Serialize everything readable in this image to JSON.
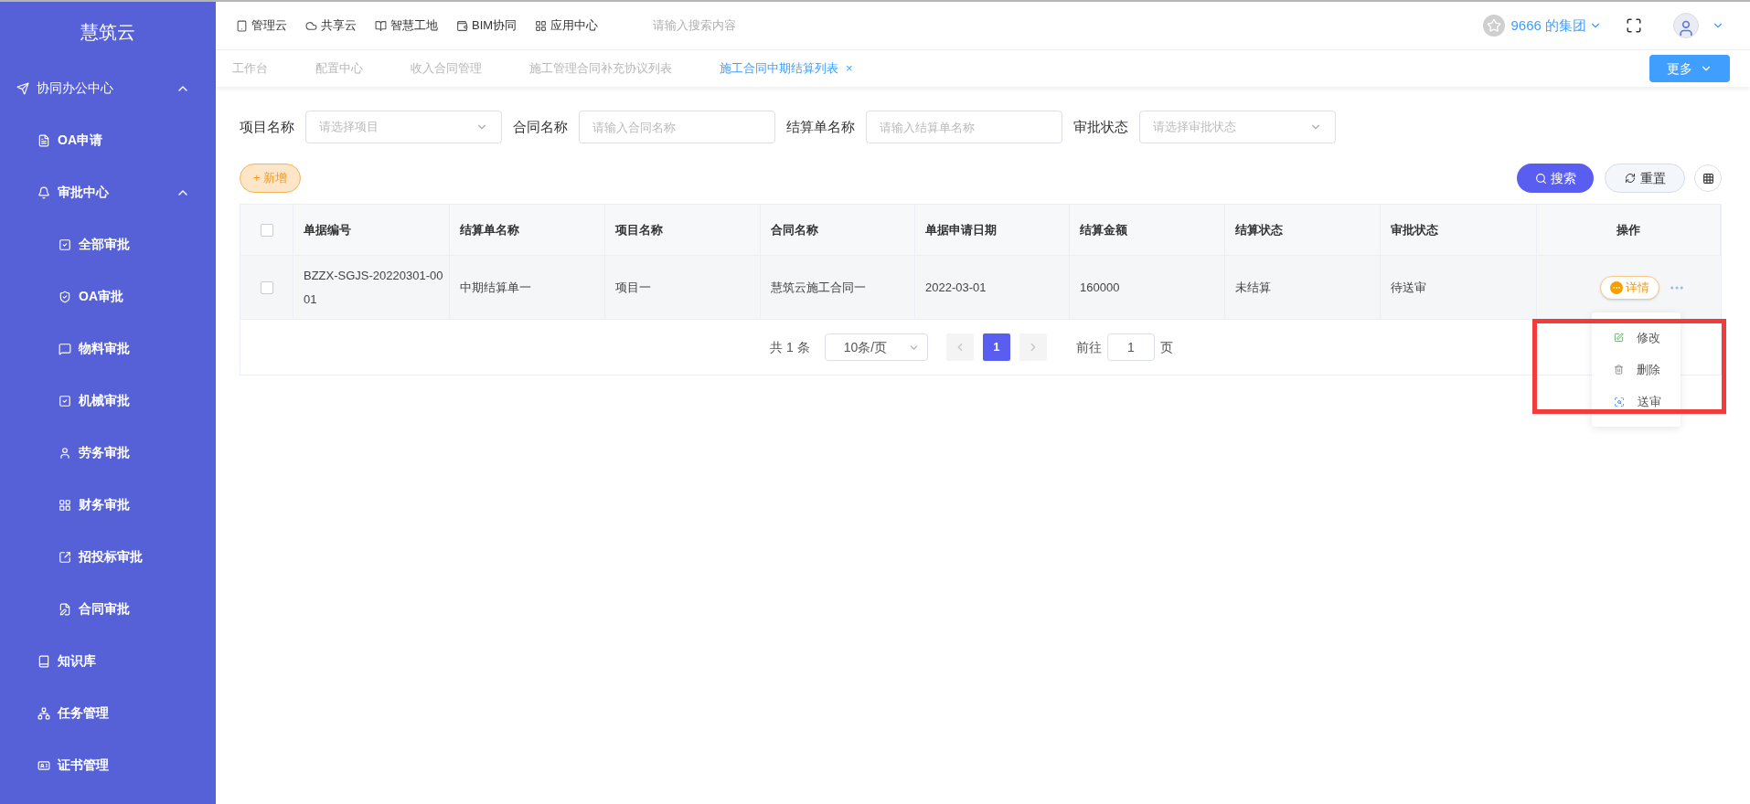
{
  "sidebar": {
    "title": "慧筑云",
    "items": [
      {
        "label": "协同办公中心",
        "expanded": true,
        "children": [
          {
            "label": "OA申请"
          },
          {
            "label": "审批中心",
            "expanded": true,
            "children": [
              {
                "label": "全部审批"
              },
              {
                "label": "OA审批"
              },
              {
                "label": "物料审批"
              },
              {
                "label": "机械审批"
              },
              {
                "label": "劳务审批"
              },
              {
                "label": "财务审批"
              },
              {
                "label": "招投标审批"
              },
              {
                "label": "合同审批"
              }
            ]
          },
          {
            "label": "知识库"
          },
          {
            "label": "任务管理"
          },
          {
            "label": "证书管理"
          }
        ]
      }
    ]
  },
  "top_nav": {
    "links": [
      "管理云",
      "共享云",
      "智慧工地",
      "BIM协同",
      "应用中心"
    ],
    "search": {
      "placeholder": "请输入搜索内容"
    },
    "org": "9666 的集团"
  },
  "tabs": [
    {
      "label": "工作台",
      "selected": false
    },
    {
      "label": "配置中心",
      "selected": false
    },
    {
      "label": "收入合同管理",
      "selected": false
    },
    {
      "label": "施工管理合同补充协议列表",
      "selected": false
    },
    {
      "label": "施工合同中期结算列表",
      "selected": true,
      "close": "×"
    }
  ],
  "more_button": "更多",
  "filters": [
    {
      "kind": "select",
      "label": "项目名称",
      "placeholder": "请选择项目"
    },
    {
      "kind": "input",
      "label": "合同名称",
      "placeholder": "请输入合同名称"
    },
    {
      "kind": "input",
      "label": "结算单名称",
      "placeholder": "请输入结算单名称"
    },
    {
      "kind": "select",
      "label": "审批状态",
      "placeholder": "请选择审批状态"
    }
  ],
  "add_button": "+ 新增",
  "search_button": "搜索",
  "reset_button": "重置",
  "table": {
    "header_checked": false,
    "columns": [
      "单据编号",
      "结算单名称",
      "项目名称",
      "合同名称",
      "单据申请日期",
      "结算金额",
      "结算状态",
      "审批状态",
      "操作"
    ],
    "rows": [
      {
        "checked": false,
        "cells": [
          "BZZX-SGJS-20220301-0001",
          "中期结算单一",
          "项目一",
          "慧筑云施工合同一",
          "2022-03-01",
          "160000",
          "未结算",
          "待送审"
        ],
        "detail": "详情"
      }
    ]
  },
  "pagination": {
    "total": "共 1 条",
    "page_size": "10条/页",
    "pages": [
      {
        "label": "1",
        "selected": true
      }
    ],
    "goto_label": "前往",
    "goto_value": "1",
    "goto_suffix": "页"
  },
  "action_menu": {
    "items": [
      {
        "kind": "edit",
        "label": "修改"
      },
      {
        "kind": "delete",
        "label": "删除"
      },
      {
        "kind": "submit",
        "label": "送审"
      }
    ]
  }
}
